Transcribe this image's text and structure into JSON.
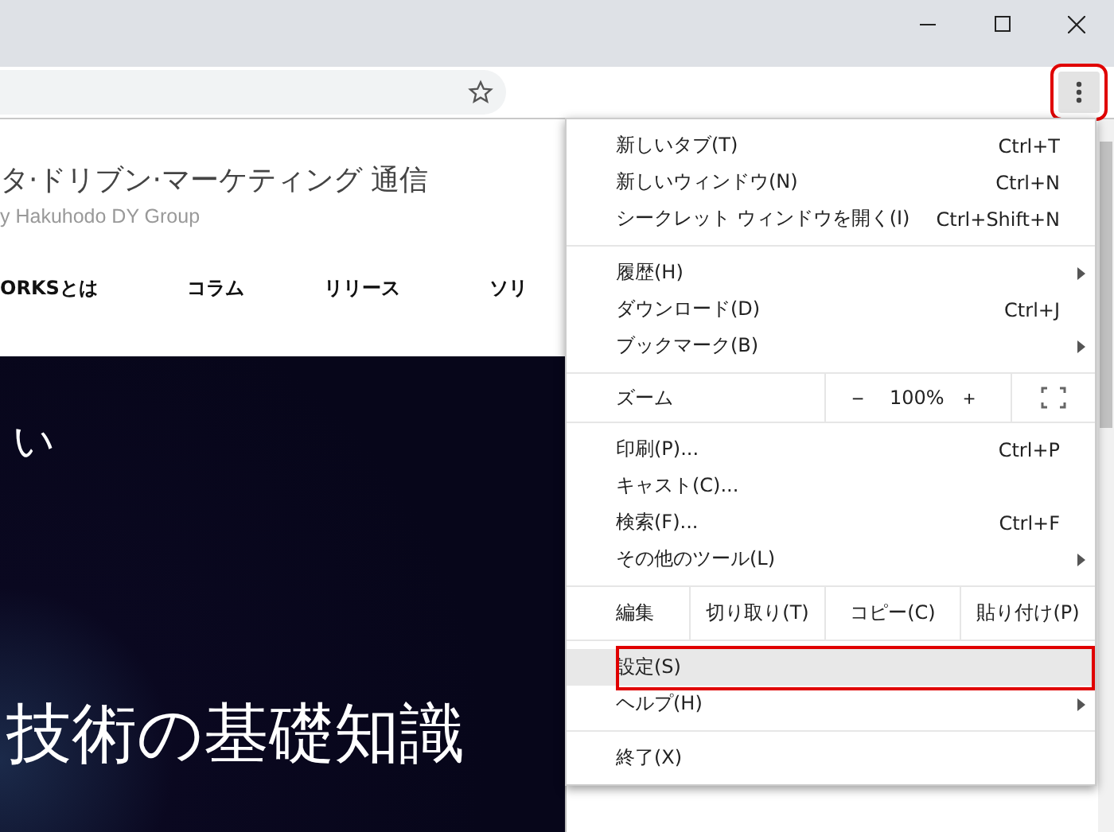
{
  "toolbar": {
    "bookmarked": false,
    "menu_button": {
      "annotated": true
    }
  },
  "page": {
    "site_title": "タ·ドリブン·マーケティング 通信",
    "site_subtitle": "y Hakuhodo DY Group",
    "nav": [
      "ORKSとは",
      "コラム",
      "リリース",
      "ソリ"
    ],
    "hero_lines": [
      "い",
      "技術の基礎知識"
    ]
  },
  "menu": {
    "sections": [
      {
        "rows": [
          {
            "kind": "item",
            "label": "新しいタブ(T)",
            "shortcut": "Ctrl+T",
            "submenu": false,
            "selected": false,
            "annotated": false
          },
          {
            "kind": "item",
            "label": "新しいウィンドウ(N)",
            "shortcut": "Ctrl+N",
            "submenu": false,
            "selected": false,
            "annotated": false
          },
          {
            "kind": "item",
            "label": "シークレット ウィンドウを開く(I)",
            "shortcut": "Ctrl+Shift+N",
            "submenu": false,
            "selected": false,
            "annotated": false
          }
        ]
      },
      {
        "rows": [
          {
            "kind": "item",
            "label": "履歴(H)",
            "submenu": true,
            "selected": false,
            "annotated": false
          },
          {
            "kind": "item",
            "label": "ダウンロード(D)",
            "shortcut": "Ctrl+J",
            "submenu": false,
            "selected": false,
            "annotated": false
          },
          {
            "kind": "item",
            "label": "ブックマーク(B)",
            "submenu": true,
            "selected": false,
            "annotated": false
          }
        ]
      },
      {
        "rows": [
          {
            "kind": "zoom",
            "label": "ズーム",
            "minus": "−",
            "value": "100%",
            "plus": "+"
          }
        ]
      },
      {
        "rows": [
          {
            "kind": "item",
            "label": "印刷(P)...",
            "shortcut": "Ctrl+P",
            "submenu": false,
            "selected": false,
            "annotated": false
          },
          {
            "kind": "item",
            "label": "キャスト(C)...",
            "submenu": false,
            "selected": false,
            "annotated": false
          },
          {
            "kind": "item",
            "label": "検索(F)...",
            "shortcut": "Ctrl+F",
            "submenu": false,
            "selected": false,
            "annotated": false
          },
          {
            "kind": "item",
            "label": "その他のツール(L)",
            "submenu": true,
            "selected": false,
            "annotated": false
          }
        ]
      },
      {
        "rows": [
          {
            "kind": "edit",
            "label": "編集",
            "buttons": [
              "切り取り(T)",
              "コピー(C)",
              "貼り付け(P)"
            ]
          }
        ]
      },
      {
        "rows": [
          {
            "kind": "item",
            "label": "設定(S)",
            "submenu": false,
            "selected": true,
            "annotated": true
          },
          {
            "kind": "item",
            "label": "ヘルプ(H)",
            "submenu": true,
            "selected": false,
            "annotated": false
          }
        ]
      },
      {
        "rows": [
          {
            "kind": "item",
            "label": "終了(X)",
            "submenu": false,
            "selected": false,
            "annotated": false
          }
        ]
      }
    ]
  }
}
